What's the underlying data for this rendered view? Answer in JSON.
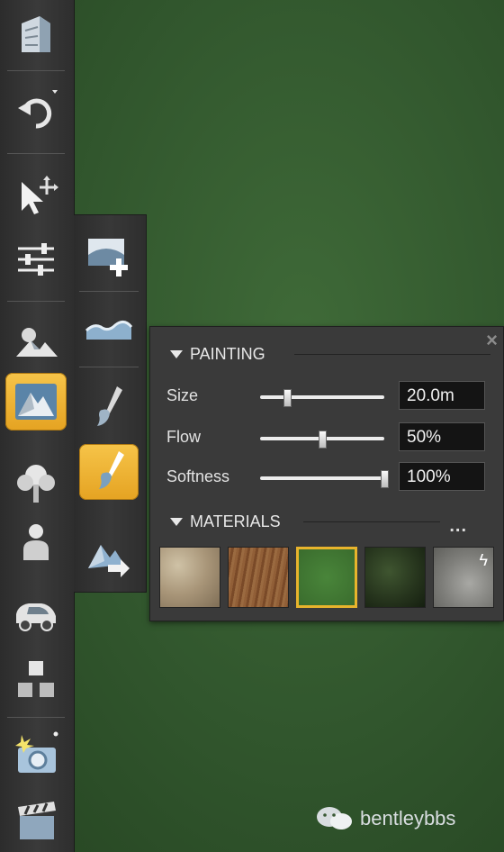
{
  "colors": {
    "active_tool": "#f0b83a",
    "panel_bg": "#3a3a3a",
    "canvas_green": "#31562d",
    "selected_material_border": "#e8b42c"
  },
  "toolbar": {
    "items": [
      {
        "name": "building-icon"
      },
      {
        "name": "undo-icon"
      },
      {
        "name": "select-move-icon"
      },
      {
        "name": "settings-sliders-icon"
      },
      {
        "name": "landscape-icon"
      },
      {
        "name": "terrain-icon",
        "active": true
      },
      {
        "name": "tree-icon"
      },
      {
        "name": "person-icon"
      },
      {
        "name": "car-icon"
      },
      {
        "name": "objects-icon"
      },
      {
        "name": "camera-icon"
      },
      {
        "name": "clapperboard-icon"
      }
    ]
  },
  "subtoolbar": {
    "items": [
      {
        "name": "new-terrain-icon"
      },
      {
        "name": "water-surface-icon"
      },
      {
        "name": "sculpt-brush-icon"
      },
      {
        "name": "paint-brush-icon",
        "active": true
      },
      {
        "name": "export-terrain-icon"
      }
    ]
  },
  "panel": {
    "close_label": "×",
    "painting": {
      "title": "PAINTING",
      "size": {
        "label": "Size",
        "value": "20.0m",
        "slider": 0.22
      },
      "flow": {
        "label": "Flow",
        "value": "50%",
        "slider": 0.5
      },
      "softness": {
        "label": "Softness",
        "value": "100%",
        "slider": 1.0
      }
    },
    "materials": {
      "title": "MATERIALS",
      "more_label": "...",
      "swatches": [
        {
          "name": "sand-material",
          "color": "#b8a78a"
        },
        {
          "name": "dirt-material",
          "color": "#8a5a34"
        },
        {
          "name": "grass-material",
          "color": "#3f7a30",
          "selected": true
        },
        {
          "name": "forest-floor-material",
          "color": "#2d3b22"
        },
        {
          "name": "rock-material",
          "color": "#8f8f8d",
          "flash": "ϟ"
        }
      ]
    }
  },
  "watermark": {
    "text": "bentleybbs"
  }
}
